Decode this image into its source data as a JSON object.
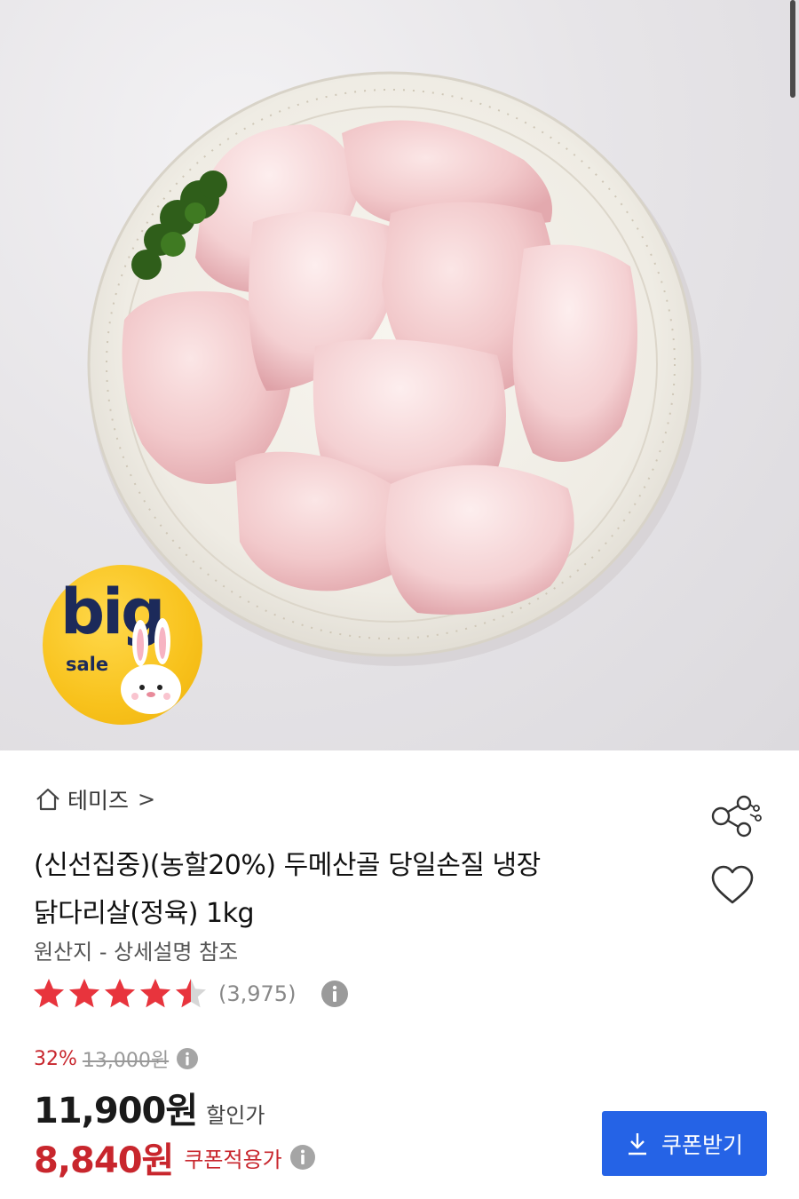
{
  "hero": {
    "image_icon": "chicken-thigh-plate-image",
    "badge": {
      "big": "big",
      "sale": "sale",
      "icon": "rabbit-icon"
    }
  },
  "store": {
    "icon": "home-icon",
    "name": "테미즈",
    "chevron": ">"
  },
  "actions": {
    "share_icon": "share-icon",
    "like_icon": "heart-icon"
  },
  "product": {
    "title_line1": "(신선집중)(농할20%) 두메산골 당일손질 냉장",
    "title_line2": "닭다리살(정육) 1kg",
    "origin": "원산지 - 상세설명 참조"
  },
  "rating": {
    "score": 4.5,
    "max": 5,
    "count": "(3,975)",
    "star_color": "#e8343d"
  },
  "price": {
    "discount_rate": "32%",
    "original_price": "13,000원",
    "sale_price": "11,900원",
    "sale_label": "할인가",
    "coupon_price": "8,840원",
    "coupon_label": "쿠폰적용가"
  },
  "coupon_button": {
    "label": "쿠폰받기",
    "icon": "download-icon",
    "color": "#2563e6"
  },
  "colors": {
    "accent_red": "#c8262d",
    "accent_blue": "#2563e6"
  }
}
